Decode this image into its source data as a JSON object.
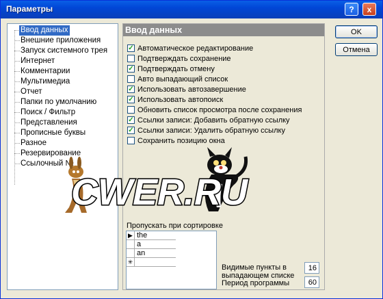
{
  "window": {
    "title": "Параметры"
  },
  "titlebar": {
    "help_glyph": "?",
    "close_glyph": "x"
  },
  "nav": {
    "items": [
      {
        "label": "Ввод данных",
        "selected": true
      },
      {
        "label": "Внешние приложения"
      },
      {
        "label": "Запуск системного трея"
      },
      {
        "label": "Интернет"
      },
      {
        "label": "Комментарии"
      },
      {
        "label": "Мультимедиа"
      },
      {
        "label": "Отчет"
      },
      {
        "label": "Папки по умолчанию"
      },
      {
        "label": "Поиск / Фильтр"
      },
      {
        "label": "Представления"
      },
      {
        "label": "Прописные буквы"
      },
      {
        "label": "Разное"
      },
      {
        "label": "Резервирование"
      },
      {
        "label": "Ссылочный №"
      }
    ]
  },
  "panel": {
    "header": "Ввод данных",
    "options": [
      {
        "label": "Автоматическое редактирование",
        "checked": true
      },
      {
        "label": "Подтверждать сохранение",
        "checked": false
      },
      {
        "label": "Подтверждать отмену",
        "checked": true
      },
      {
        "label": "Авто выпадающий список",
        "checked": false
      },
      {
        "label": "Использовать автозавершение",
        "checked": true
      },
      {
        "label": "Использовать автопоиск",
        "checked": true
      },
      {
        "label": "Обновить список просмотра после сохранения",
        "checked": false
      },
      {
        "label": "Ссылки записи: Добавить обратную ссылку",
        "checked": true
      },
      {
        "label": "Ссылки записи: Удалить обратную ссылку",
        "checked": true
      },
      {
        "label": "Сохранить позицию окна",
        "checked": false
      }
    ],
    "ignore_label": "Пропускать при сортировке",
    "ignore_words": [
      "the",
      "a",
      "an"
    ],
    "new_row_marker": "✳",
    "current_row_marker": "▶",
    "visible_items_label_1": "Видимые пункты в",
    "visible_items_label_2": "выпадающем списке",
    "visible_items_value": "16",
    "program_period_label": "Период программы",
    "program_period_value": "60"
  },
  "buttons": {
    "ok": "OK",
    "cancel": "Отмена"
  },
  "watermark": {
    "text": "CWER.RU"
  }
}
